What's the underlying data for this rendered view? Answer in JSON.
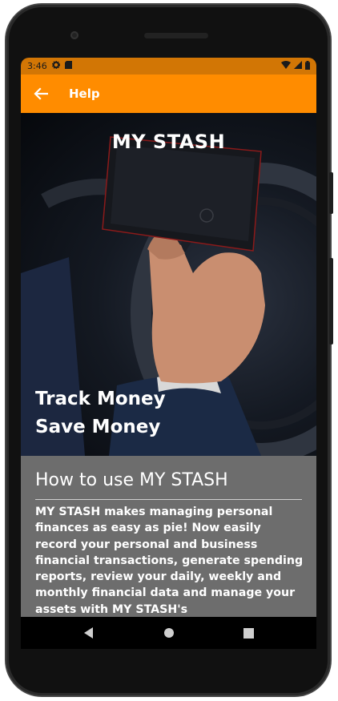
{
  "status_bar": {
    "time": "3:46",
    "icons_left": [
      "settings-icon",
      "sd-card-icon"
    ],
    "icons_right": [
      "wifi-icon",
      "signal-icon",
      "battery-icon"
    ],
    "background": "#d27605"
  },
  "app_bar": {
    "title": "Help",
    "background": "#ff8c00",
    "back_icon": "arrow-left-icon"
  },
  "hero": {
    "brand": "MY STASH",
    "tagline_line1": "Track Money",
    "tagline_line2": "Save Money"
  },
  "help": {
    "heading": "How to use MY STASH",
    "body": "MY STASH makes managing personal finances as easy as pie! Now easily record your personal and business financial transactions, generate spending reports, review your daily, weekly and monthly financial data and manage your assets with MY STASH's",
    "background": "#6d6d6d"
  },
  "nav_bar": {
    "icons": [
      "back-triangle-icon",
      "home-circle-icon",
      "recents-square-icon"
    ]
  }
}
